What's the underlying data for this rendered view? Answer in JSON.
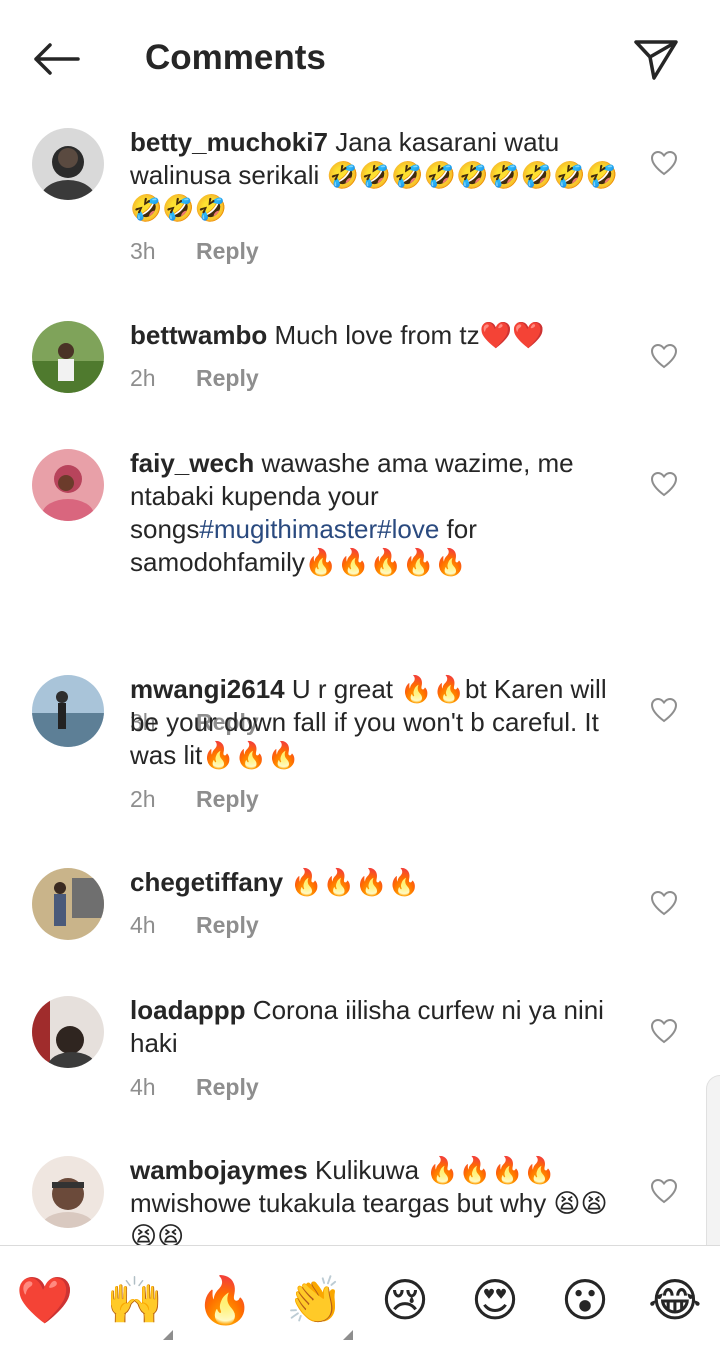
{
  "header": {
    "title": "Comments",
    "back_icon": "arrow-left-icon",
    "send_icon": "paper-plane-icon"
  },
  "comments": [
    {
      "username": "betty_muchoki7",
      "text": "Jana kasarani watu walinusa serikali 🤣🤣🤣🤣🤣🤣🤣🤣🤣🤣🤣🤣",
      "time": "3h",
      "reply": "Reply"
    },
    {
      "username": "bettwambo",
      "text": "Much love from tz❤️❤️",
      "time": "2h",
      "reply": "Reply"
    },
    {
      "username": "faiy_wech",
      "text_before": "wawashe ama wazime, me ntabaki kupenda your songs",
      "hashtags": "#mugithimaster#love",
      "text_after": " for samodohfamily🔥🔥🔥🔥🔥",
      "time": "3h",
      "reply": "Reply"
    },
    {
      "username": "mwangi2614",
      "text": "U r great 🔥🔥bt Karen will be your down fall if you won't b careful. It was lit🔥🔥🔥",
      "time": "2h",
      "reply": "Reply"
    },
    {
      "username": "chegetiffany",
      "text": "🔥🔥🔥🔥",
      "time": "4h",
      "reply": "Reply"
    },
    {
      "username": "loadappp",
      "text": "Corona iilisha curfew ni ya nini haki",
      "time": "4h",
      "reply": "Reply"
    },
    {
      "username": "wambojaymes",
      "text": "Kulikuwa 🔥🔥🔥🔥 mwishowe tukakula teargas but why 😫😫😫😫",
      "time": "",
      "reply": ""
    }
  ],
  "emoji_bar": [
    "❤️",
    "🙌",
    "🔥",
    "👏",
    "😢",
    "😍",
    "😮",
    "😂"
  ],
  "colors": {
    "text": "#262626",
    "meta": "#8e8e8e",
    "hashtag": "#2a4a7f",
    "divider": "#dbdbdb"
  }
}
